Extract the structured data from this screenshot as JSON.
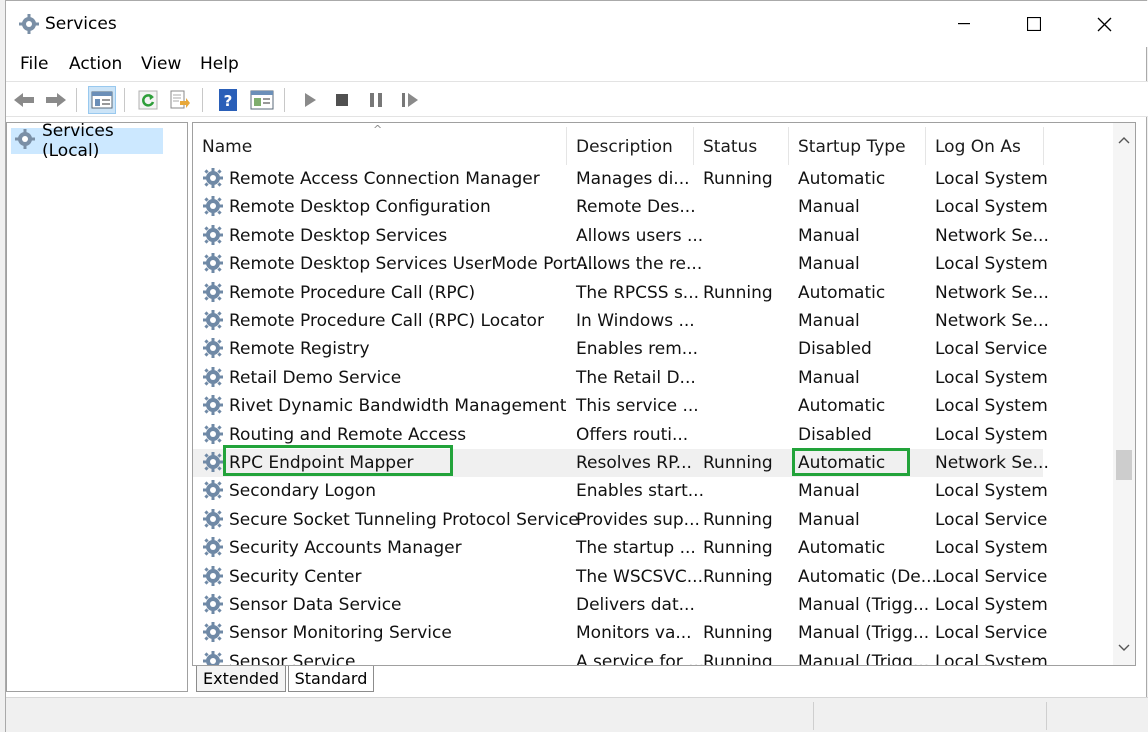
{
  "window": {
    "title": "Services",
    "minimize_glyph": "—",
    "maximize_glyph": "☐",
    "close_glyph": "✕"
  },
  "menu": [
    "File",
    "Action",
    "View",
    "Help"
  ],
  "toolbar": [
    "back-arrow-icon",
    "forward-arrow-icon",
    "show-hide-console-tree-icon",
    "refresh-icon",
    "export-list-icon",
    "help-icon",
    "properties-pane-icon",
    "start-service-icon",
    "stop-service-icon",
    "pause-service-icon",
    "resume-service-icon"
  ],
  "tree": {
    "label": "Services (Local)"
  },
  "columns": {
    "name": "Name",
    "description": "Description",
    "status": "Status",
    "startup": "Startup Type",
    "logon": "Log On As"
  },
  "services": [
    {
      "name": "Remote Access Connection Manager",
      "description": "Manages di...",
      "status": "Running",
      "startup": "Automatic",
      "logon": "Local System"
    },
    {
      "name": "Remote Desktop Configuration",
      "description": "Remote Des...",
      "status": "",
      "startup": "Manual",
      "logon": "Local System"
    },
    {
      "name": "Remote Desktop Services",
      "description": "Allows users ...",
      "status": "",
      "startup": "Manual",
      "logon": "Network Se..."
    },
    {
      "name": "Remote Desktop Services UserMode Port ...",
      "description": "Allows the re...",
      "status": "",
      "startup": "Manual",
      "logon": "Local System"
    },
    {
      "name": "Remote Procedure Call (RPC)",
      "description": "The RPCSS s...",
      "status": "Running",
      "startup": "Automatic",
      "logon": "Network Se..."
    },
    {
      "name": "Remote Procedure Call (RPC) Locator",
      "description": "In Windows ...",
      "status": "",
      "startup": "Manual",
      "logon": "Network Se..."
    },
    {
      "name": "Remote Registry",
      "description": "Enables rem...",
      "status": "",
      "startup": "Disabled",
      "logon": "Local Service"
    },
    {
      "name": "Retail Demo Service",
      "description": "The Retail D...",
      "status": "",
      "startup": "Manual",
      "logon": "Local System"
    },
    {
      "name": "Rivet Dynamic Bandwidth Management",
      "description": "This service ...",
      "status": "",
      "startup": "Automatic",
      "logon": "Local System"
    },
    {
      "name": "Routing and Remote Access",
      "description": "Offers routi...",
      "status": "",
      "startup": "Disabled",
      "logon": "Local System"
    },
    {
      "name": "RPC Endpoint Mapper",
      "description": "Resolves RP...",
      "status": "Running",
      "startup": "Automatic",
      "logon": "Network Se...",
      "selected": true
    },
    {
      "name": "Secondary Logon",
      "description": "Enables start...",
      "status": "",
      "startup": "Manual",
      "logon": "Local System"
    },
    {
      "name": "Secure Socket Tunneling Protocol Service",
      "description": "Provides sup...",
      "status": "Running",
      "startup": "Manual",
      "logon": "Local Service"
    },
    {
      "name": "Security Accounts Manager",
      "description": "The startup ...",
      "status": "Running",
      "startup": "Automatic",
      "logon": "Local System"
    },
    {
      "name": "Security Center",
      "description": "The WSCSVC...",
      "status": "Running",
      "startup": "Automatic (De...",
      "logon": "Local Service"
    },
    {
      "name": "Sensor Data Service",
      "description": "Delivers dat...",
      "status": "",
      "startup": "Manual (Trigg...",
      "logon": "Local System"
    },
    {
      "name": "Sensor Monitoring Service",
      "description": "Monitors va...",
      "status": "Running",
      "startup": "Manual (Trigg...",
      "logon": "Local Service"
    },
    {
      "name": "Sensor Service",
      "description": "A service for ...",
      "status": "Running",
      "startup": "Manual (Trigg...",
      "logon": "Local System"
    }
  ],
  "tabs": [
    "Extended",
    "Standard"
  ],
  "colors": {
    "highlight_border": "#22a33a",
    "tree_selection": "#cce8ff",
    "row_selection": "#f0f0f0"
  }
}
